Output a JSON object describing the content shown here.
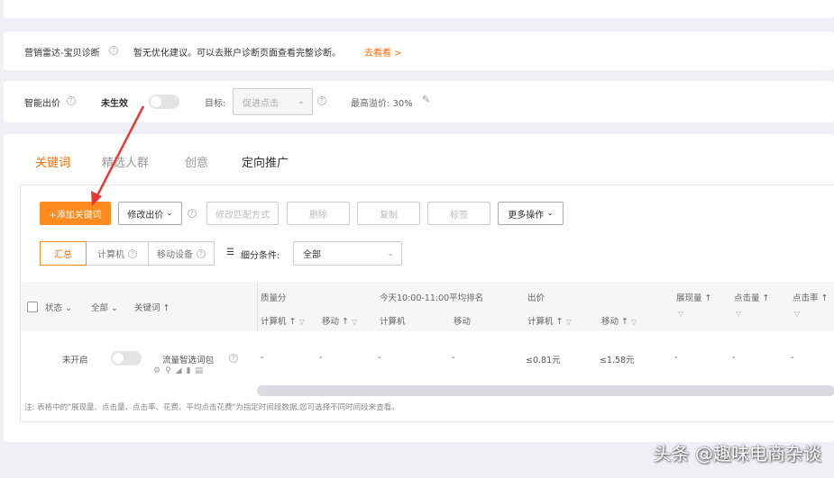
{
  "diagnosis": {
    "label": "营销雷达-宝贝诊断",
    "message": "暂无优化建议。可以去账户诊断页面查看完整诊断。",
    "link": "去看看 >"
  },
  "smart_bid": {
    "label": "智能出价",
    "status": "未生效",
    "target_label": "目标:",
    "target_value": "促进点击",
    "premium": "最高溢价: 30%"
  },
  "tabs": [
    {
      "label": "关键词"
    },
    {
      "label": "精选人群"
    },
    {
      "label": "创意"
    },
    {
      "label": "定向推广"
    }
  ],
  "toolbar": {
    "add_keyword": "+添加关键词",
    "modify_bid": "修改出价",
    "modify_match": "修改匹配方式",
    "delete": "删除",
    "copy": "复制",
    "tag": "标签",
    "more": "更多操作"
  },
  "segments": [
    "汇总",
    "计算机",
    "移动设备"
  ],
  "breakdown": {
    "label": "细分条件:",
    "value": "全部"
  },
  "table": {
    "headers": {
      "status": "状态",
      "all": "全部",
      "keyword": "关键词",
      "quality": "质量分",
      "quality_pc": "计算机",
      "quality_mobile": "移动",
      "rank": "今天10:00-11:00平均排名",
      "rank_pc": "计算机",
      "rank_mobile": "移动",
      "bid": "出价",
      "bid_pc": "计算机",
      "bid_mobile": "移动",
      "impressions": "展现量",
      "clicks": "点击量",
      "ctr": "点击率"
    },
    "row": {
      "status": "未开启",
      "keyword": "流量智选词包",
      "quality_pc": "-",
      "quality_mobile": "-",
      "rank_pc": "-",
      "rank_mobile": "-",
      "bid_pc": "≤0.81元",
      "bid_mobile": "≤1.58元",
      "impressions": "-",
      "clicks": "-",
      "ctr": "-"
    }
  },
  "note": "注: 表格中的\"展现量、点击量、点击率、花费、平均点击花费\"为指定时间段数据,您可选择不同时间段来查看。",
  "watermark": "头条 @趣味电商杂谈",
  "colors": {
    "accent": "#ff6a00",
    "arrow": "#e53935"
  }
}
